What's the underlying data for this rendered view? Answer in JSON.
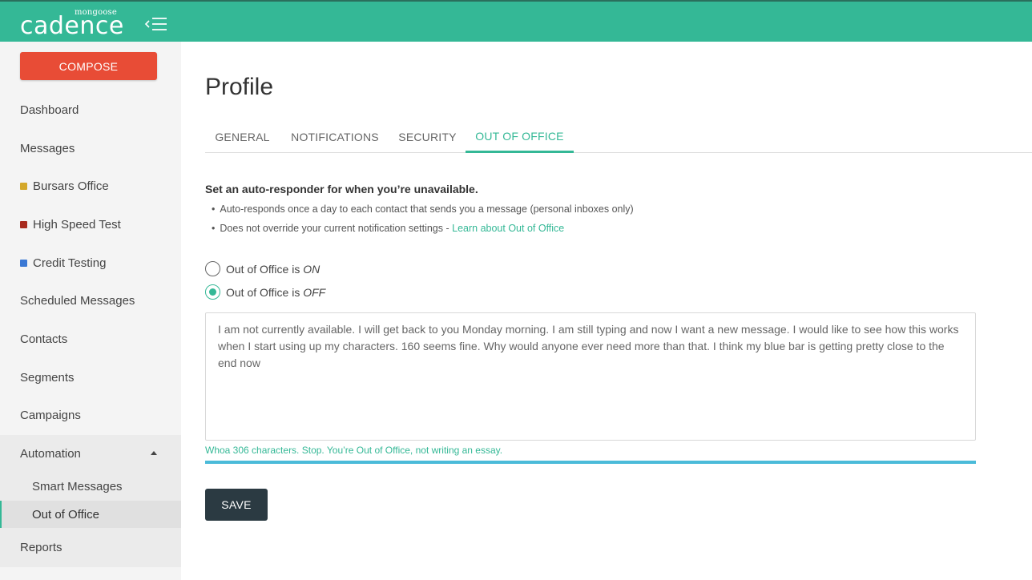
{
  "app": {
    "brand_small": "mongoose",
    "brand_word": "cadence"
  },
  "sidebar": {
    "compose_label": "COMPOSE",
    "items": [
      {
        "label": "Dashboard"
      },
      {
        "label": "Messages"
      },
      {
        "label": "Bursars Office",
        "color": "#d4a82a"
      },
      {
        "label": "High Speed Test",
        "color": "#a82a1e"
      },
      {
        "label": "Credit Testing",
        "color": "#3a78d4"
      },
      {
        "label": "Scheduled Messages"
      },
      {
        "label": "Contacts"
      },
      {
        "label": "Segments"
      },
      {
        "label": "Campaigns"
      },
      {
        "label": "Automation"
      },
      {
        "label": "Reports"
      }
    ],
    "automation_sub": [
      {
        "label": "Smart Messages"
      },
      {
        "label": "Out of Office"
      }
    ]
  },
  "main": {
    "title": "Profile",
    "tabs": [
      {
        "label": "GENERAL"
      },
      {
        "label": "NOTIFICATIONS"
      },
      {
        "label": "SECURITY"
      },
      {
        "label": "OUT OF OFFICE"
      }
    ],
    "intro": "Set an auto-responder for when you’re unavailable.",
    "bullets": [
      "Auto-responds once a day to each contact that sends you a message (personal inboxes only)",
      "Does not override your current notification settings - "
    ],
    "learn_link": "Learn about Out of Office",
    "radio_on_prefix": "Out of Office is ",
    "radio_on_state": "ON",
    "radio_off_prefix": "Out of Office is ",
    "radio_off_state": "OFF",
    "message_text": "I am not currently available. I will get back to you Monday morning. I am still typing and now I want a new message. I would like to see how this works when I start using up my characters. 160 seems fine. Why would anyone ever need more than that. I think my blue bar is getting pretty close to the end now",
    "warning": "Whoa 306 characters. Stop. You’re Out of Office, not writing an essay.",
    "progress_fraction": 1.0,
    "save_label": "SAVE"
  },
  "colors": {
    "brand_green": "#34b896",
    "compose_red": "#e84c36",
    "save_dark": "#2b3a42",
    "progress_blue": "#4bbbd9"
  }
}
